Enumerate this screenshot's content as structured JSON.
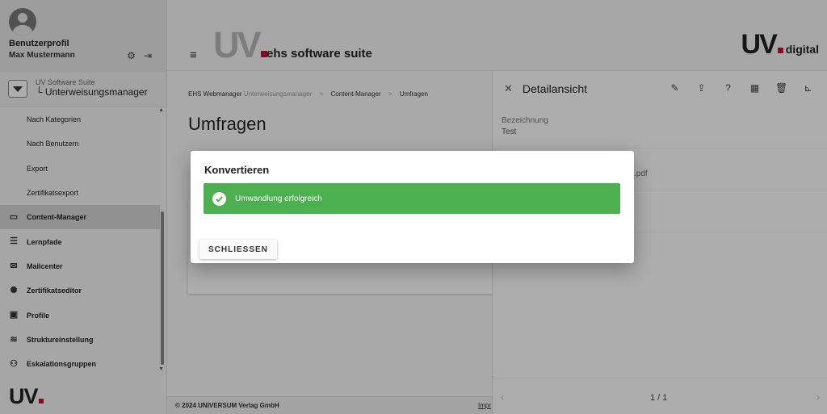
{
  "profile": {
    "title": "Benutzerprofil",
    "name": "Max Mustermann",
    "icons": [
      "gear-icon",
      "logout-icon"
    ]
  },
  "suite": {
    "line1": "UV Software Suite",
    "line2": "└ Unterweisungsmanager"
  },
  "sidebar": {
    "items": [
      {
        "label": "Nach Kategorien",
        "icon": "",
        "top": false
      },
      {
        "label": "Nach Benutzern",
        "icon": "",
        "top": false
      },
      {
        "label": "Export",
        "icon": "",
        "top": false
      },
      {
        "label": "Zertifikatsexport",
        "icon": "",
        "top": false
      },
      {
        "label": "Content-Manager",
        "icon": "presentation-icon",
        "top": true,
        "active": true
      },
      {
        "label": "Lernpfade",
        "icon": "list-icon",
        "top": true
      },
      {
        "label": "Mailcenter",
        "icon": "mail-icon",
        "top": true
      },
      {
        "label": "Zertifikatseditor",
        "icon": "certificate-icon",
        "top": true
      },
      {
        "label": "Profile",
        "icon": "folder-icon",
        "top": true
      },
      {
        "label": "Struktureinstellung",
        "icon": "layers-icon",
        "top": true
      },
      {
        "label": "Eskalationsgruppen",
        "icon": "group-icon",
        "top": true
      }
    ],
    "bottom_logo": "UV"
  },
  "header": {
    "logo": "UV",
    "brand": "ehs software suite",
    "right_logo": "UV",
    "right_logo_suffix": "digital"
  },
  "main": {
    "breadcrumb": {
      "root": "EHS Webmanager",
      "root_sub": "Unterweisungsmanager",
      "level2": "Content-Manager",
      "level3": "Umfragen",
      "sep": ">"
    },
    "title": "Umfragen"
  },
  "footer": {
    "copyright": "© 2024 UNIVERSUM Verlag GmbH",
    "link": "Impr"
  },
  "detail": {
    "title": "Detailansicht",
    "field_label": "Bezeichnung",
    "field_value": "Test",
    "file_fragment": ".pdf",
    "pager": "1 / 1",
    "actions": [
      "edit-icon",
      "upload-icon",
      "help-icon",
      "film-icon",
      "delete-icon",
      "chart-icon"
    ]
  },
  "dialog": {
    "title": "Konvertieren",
    "message": "Umwandlung erfolgreich",
    "close_label": "SCHLIESSEN",
    "success_color": "#4caf50"
  }
}
